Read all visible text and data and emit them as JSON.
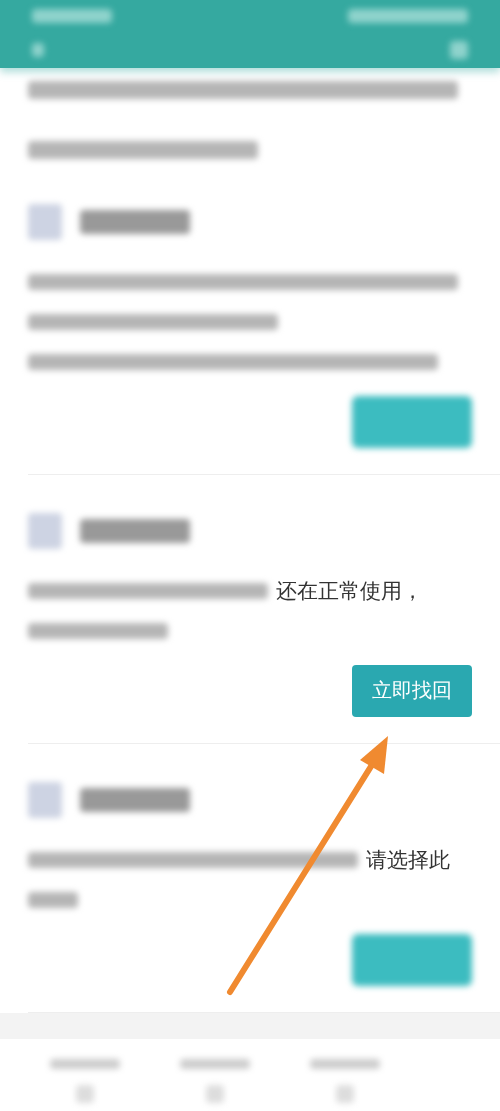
{
  "sections": [
    {
      "button": {
        "kind": "blurred"
      }
    },
    {
      "text": "还在正常使用，",
      "button": {
        "kind": "clear",
        "label": "立即找回"
      }
    },
    {
      "text": "请选择此",
      "button": {
        "kind": "blurred"
      }
    }
  ]
}
